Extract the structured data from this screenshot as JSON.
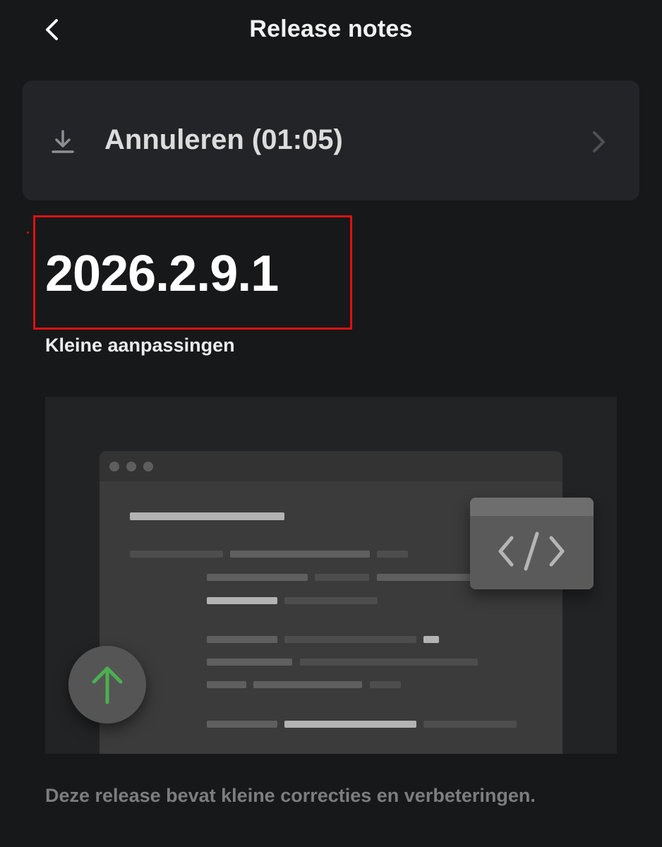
{
  "header": {
    "title": "Release notes",
    "back_icon": "chevron-left-icon"
  },
  "download": {
    "label": "Annuleren (01:05)",
    "icon": "download-icon",
    "chevron_icon": "chevron-right-icon"
  },
  "release": {
    "version": "2026.2.9.1",
    "subtitle": "Kleine aanpassingen",
    "description": "Deze release bevat kleine correcties en verbeteringen."
  },
  "illustration": {
    "code_icon": "code-brackets-icon",
    "upload_icon": "arrow-up-icon",
    "upload_arrow_color": "#4caf50"
  },
  "colors": {
    "background": "#17181a",
    "card": "#232427",
    "highlight_border": "#e01010"
  }
}
